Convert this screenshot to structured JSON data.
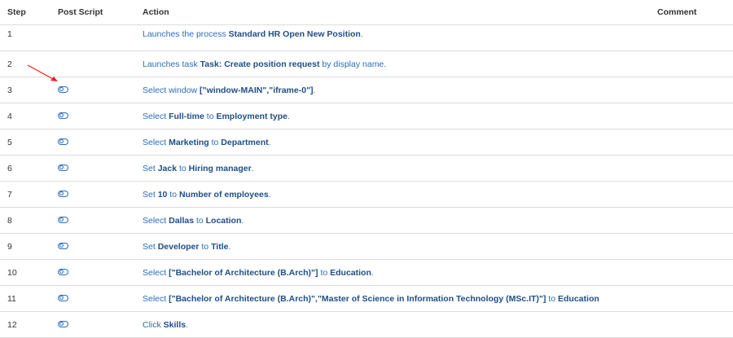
{
  "columns": {
    "step": "Step",
    "post_script": "Post Script",
    "action": "Action",
    "comment": "Comment"
  },
  "rows": [
    {
      "step": "1",
      "has_post_script": false,
      "parts": [
        [
          "Launches the process ",
          false
        ],
        [
          "Standard HR Open New Position",
          true
        ],
        [
          ".",
          false
        ]
      ]
    },
    {
      "step": "2",
      "has_post_script": false,
      "parts": [
        [
          "Launches task ",
          false
        ],
        [
          "Task: Create position request",
          true
        ],
        [
          " by display name.",
          false
        ]
      ]
    },
    {
      "step": "3",
      "has_post_script": true,
      "parts": [
        [
          "Select window ",
          false
        ],
        [
          "[\"window-MAIN\",\"iframe-0\"]",
          true
        ],
        [
          ".",
          false
        ]
      ]
    },
    {
      "step": "4",
      "has_post_script": true,
      "parts": [
        [
          "Select ",
          false
        ],
        [
          "Full-time",
          true
        ],
        [
          " to ",
          false
        ],
        [
          "Employment type",
          true
        ],
        [
          ".",
          false
        ]
      ]
    },
    {
      "step": "5",
      "has_post_script": true,
      "parts": [
        [
          "Select ",
          false
        ],
        [
          "Marketing",
          true
        ],
        [
          " to ",
          false
        ],
        [
          "Department",
          true
        ],
        [
          ".",
          false
        ]
      ]
    },
    {
      "step": "6",
      "has_post_script": true,
      "parts": [
        [
          "Set ",
          false
        ],
        [
          "Jack",
          true
        ],
        [
          " to ",
          false
        ],
        [
          "Hiring manager",
          true
        ],
        [
          ".",
          false
        ]
      ]
    },
    {
      "step": "7",
      "has_post_script": true,
      "parts": [
        [
          "Set ",
          false
        ],
        [
          "10",
          true
        ],
        [
          " to ",
          false
        ],
        [
          "Number of employees",
          true
        ],
        [
          ".",
          false
        ]
      ]
    },
    {
      "step": "8",
      "has_post_script": true,
      "parts": [
        [
          "Select ",
          false
        ],
        [
          "Dallas",
          true
        ],
        [
          " to ",
          false
        ],
        [
          "Location",
          true
        ],
        [
          ".",
          false
        ]
      ]
    },
    {
      "step": "9",
      "has_post_script": true,
      "parts": [
        [
          "Set ",
          false
        ],
        [
          "Developer",
          true
        ],
        [
          " to ",
          false
        ],
        [
          "Title",
          true
        ],
        [
          ".",
          false
        ]
      ]
    },
    {
      "step": "10",
      "has_post_script": true,
      "parts": [
        [
          "Select ",
          false
        ],
        [
          "[\"Bachelor of Architecture (B.Arch)\"]",
          true
        ],
        [
          " to ",
          false
        ],
        [
          "Education",
          true
        ],
        [
          ".",
          false
        ]
      ]
    },
    {
      "step": "11",
      "has_post_script": true,
      "parts": [
        [
          "Select ",
          false
        ],
        [
          "[\"Bachelor of Architecture (B.Arch)\",\"Master of Science in Information Technology (MSc.IT)\"]",
          true
        ],
        [
          " to ",
          false
        ],
        [
          "Education",
          true
        ]
      ]
    },
    {
      "step": "12",
      "has_post_script": true,
      "parts": [
        [
          "Click ",
          false
        ],
        [
          "Skills",
          true
        ],
        [
          ".",
          false
        ]
      ]
    }
  ],
  "icons": {
    "post_script": "toggle-icon",
    "annotation": "red-arrow-icon"
  },
  "colors": {
    "link": "#2a6ebb",
    "link_bold": "#1f4e86",
    "border": "#dddddd",
    "arrow": "#e8201b"
  }
}
